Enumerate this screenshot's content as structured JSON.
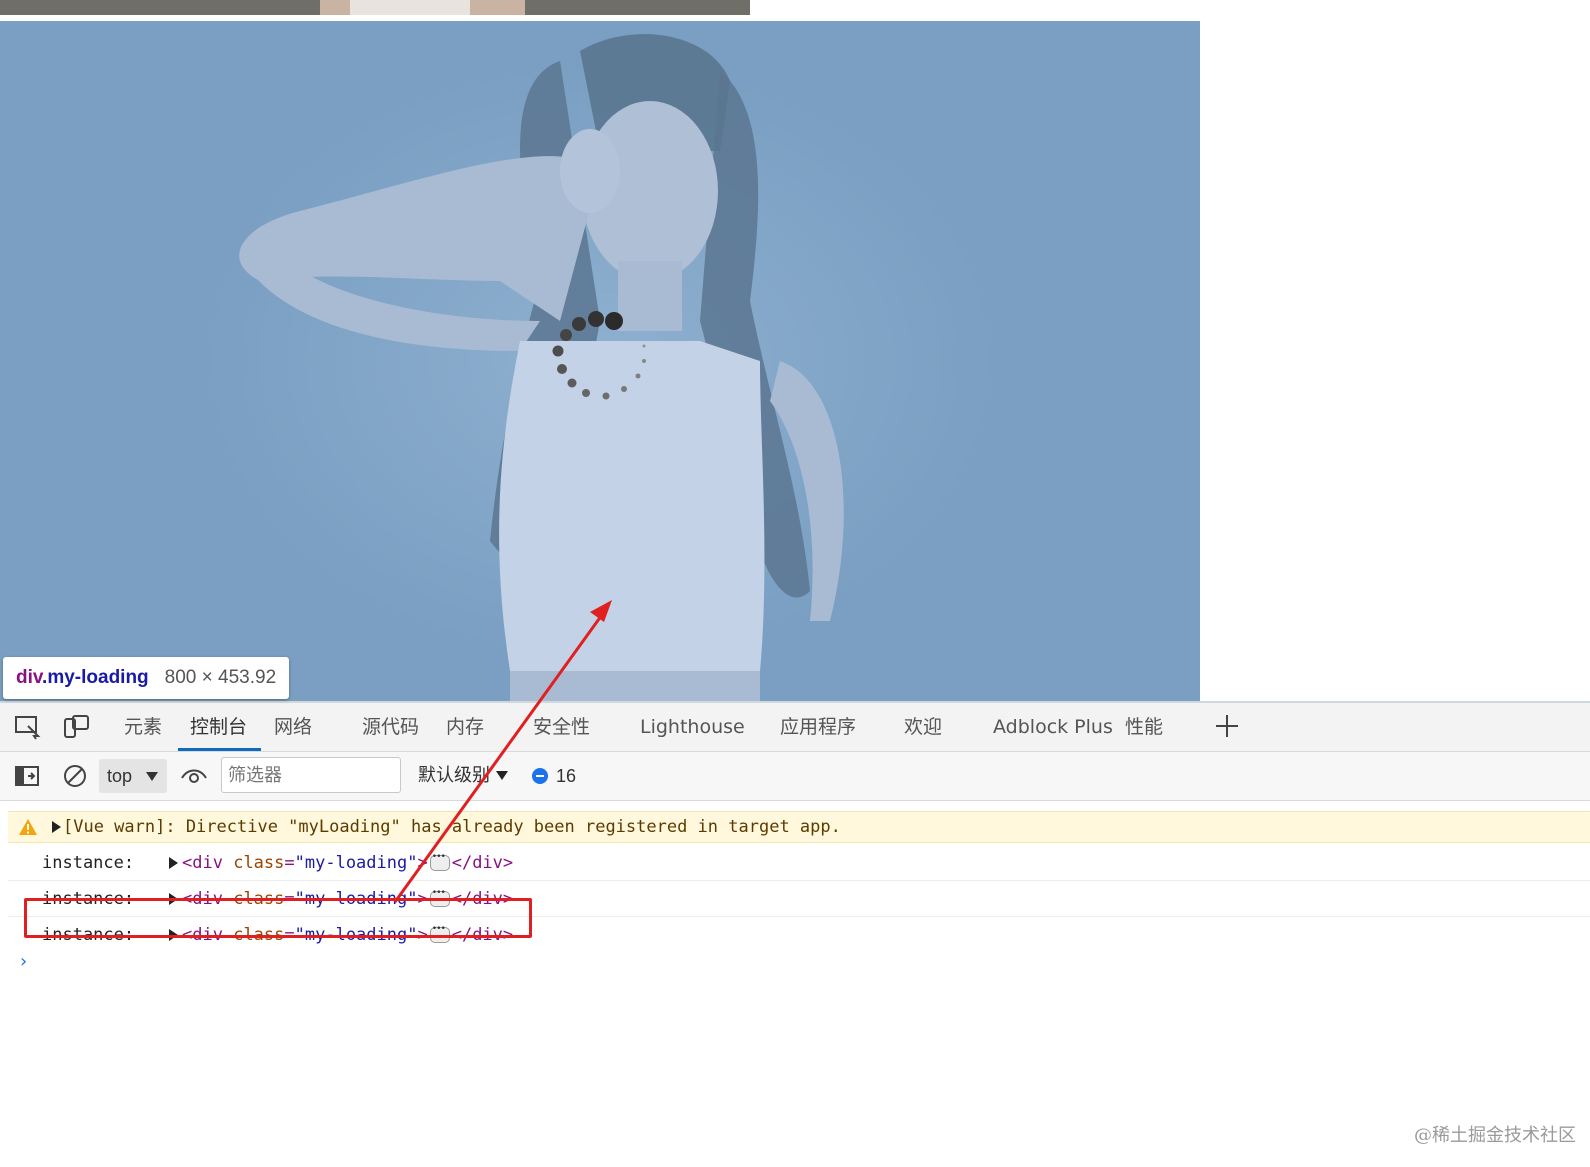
{
  "preview": {
    "tooltip_tag": "div",
    "tooltip_class": ".my-loading",
    "tooltip_dims": "800 × 453.92"
  },
  "devtools": {
    "tabs": [
      {
        "label": "元素"
      },
      {
        "label": "控制台",
        "active": true
      },
      {
        "label": "网络"
      },
      {
        "label": "源代码"
      },
      {
        "label": "内存"
      },
      {
        "label": "安全性"
      },
      {
        "label": "Lighthouse"
      },
      {
        "label": "应用程序"
      },
      {
        "label": "欢迎"
      },
      {
        "label": "Adblock Plus"
      },
      {
        "label": "性能"
      }
    ],
    "toolbar": {
      "context": "top",
      "filter_placeholder": "筛选器",
      "levels": "默认级别",
      "message_count": "16"
    },
    "console": {
      "warning": "[Vue warn]: Directive \"myLoading\" has already been registered in target app.",
      "logs": [
        {
          "label": "instance:",
          "tag_open": "<div",
          "attr": "class",
          "value": "\"my-loading\"",
          "tag_close": "</div>"
        },
        {
          "label": "instance:",
          "tag_open": "<div",
          "attr": "class",
          "value": "\"my-loading\"",
          "tag_close": "</div>"
        },
        {
          "label": "instance:",
          "tag_open": "<div",
          "attr": "class",
          "value": "\"my-loading\"",
          "tag_close": "</div>"
        }
      ],
      "prompt_symbol": "›"
    }
  },
  "watermark": "@稀土掘金技术社区",
  "colors": {
    "overlay": "#7a9fc2",
    "tab_active": "#0f6cbd",
    "annotation": "#e02020",
    "warning_bg": "#fff8dc"
  }
}
